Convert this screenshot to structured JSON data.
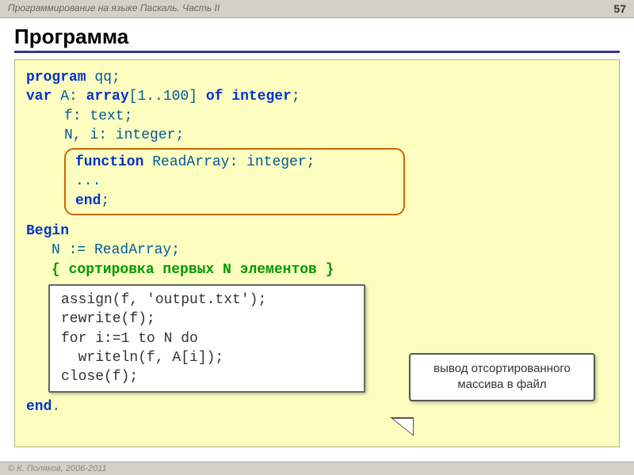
{
  "header": {
    "course_title": "Программирование на языке Паскаль. Часть II",
    "page_number": "57"
  },
  "slide": {
    "title": "Программа"
  },
  "code": {
    "line1_kw1": "program",
    "line1_name": " qq;",
    "line2_kw1": "var",
    "line2_name": " A: ",
    "line2_kw2": "array",
    "line2_range": "[1..100] ",
    "line2_kw3": "of",
    "line2_kw4": " integer",
    "line2_end": ";",
    "line3": "f: text;",
    "line4": "N, i: integer;",
    "inset_line1_kw": "function",
    "inset_line1_rest": " ReadArray: integer;",
    "inset_line2": "...",
    "inset_line3_kw": "end",
    "inset_line3_end": ";",
    "begin_kw": "Begin",
    "assign_line": "N := ReadArray;",
    "comment_line": "{ сортировка первых N элементов }",
    "wb_line1": "assign(f, 'output.txt');",
    "wb_line2": "rewrite(f);",
    "wb_line3": "for i:=1 to N do",
    "wb_line4": "  writeln(f, A[i]);",
    "wb_line5": "close(f);",
    "end_kw": "end",
    "end_dot": "."
  },
  "callout": {
    "line1": "вывод отсортированного",
    "line2": "массива в файл"
  },
  "footer": {
    "copyright": "© К. Поляков, 2006-2011"
  }
}
